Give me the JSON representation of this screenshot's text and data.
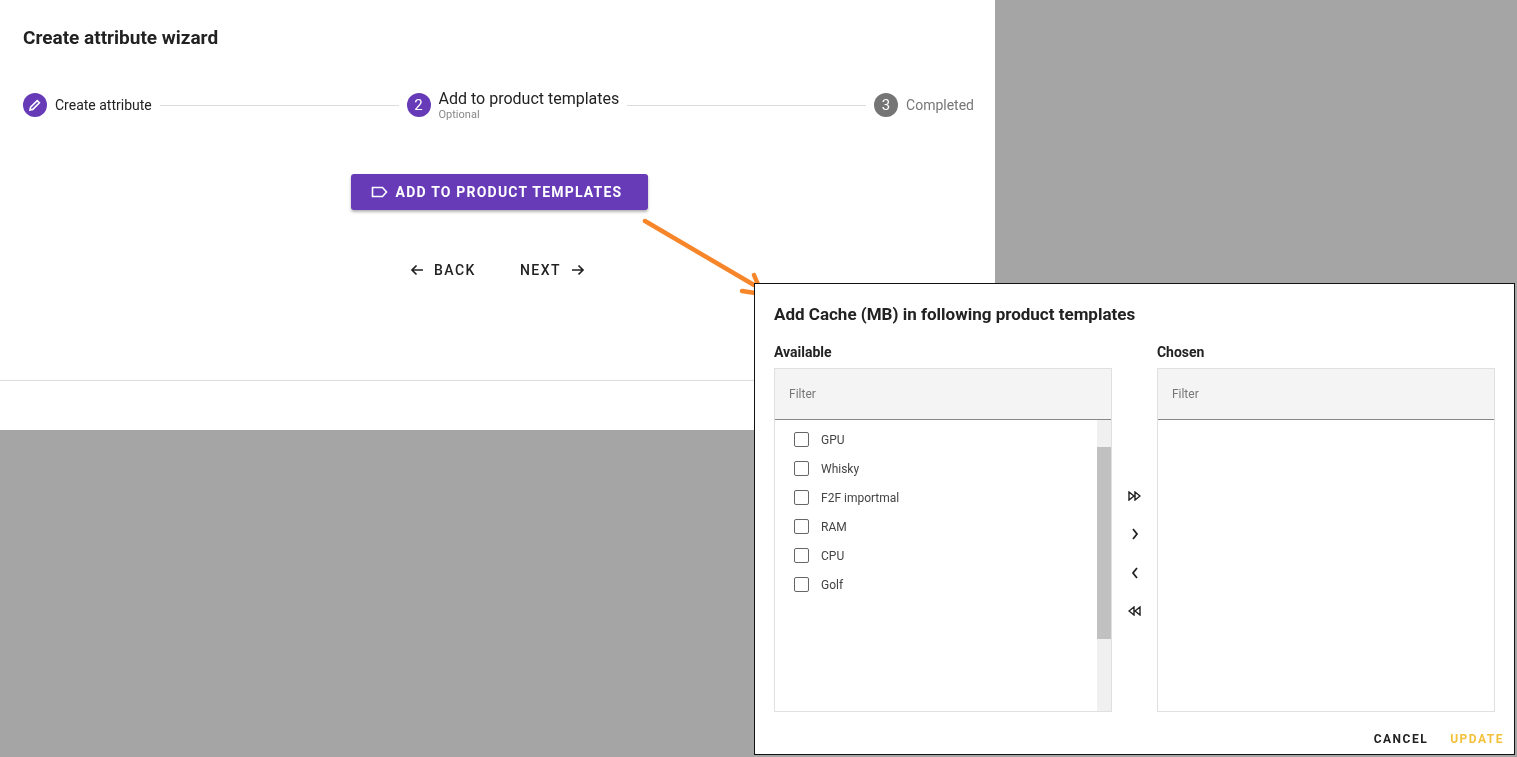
{
  "wizard": {
    "title": "Create attribute wizard",
    "steps": [
      {
        "label": "Create attribute",
        "kind": "done"
      },
      {
        "number": "2",
        "label": "Add to product templates",
        "sublabel": "Optional",
        "kind": "active"
      },
      {
        "number": "3",
        "label": "Completed",
        "kind": "pending"
      }
    ],
    "action_button": "ADD TO PRODUCT TEMPLATES",
    "back_button": "BACK",
    "next_button": "NEXT"
  },
  "dialog": {
    "title": "Add Cache (MB) in following product templates",
    "available": {
      "label": "Available",
      "filter_placeholder": "Filter",
      "items": [
        {
          "label": "GPU",
          "checked": false
        },
        {
          "label": "Whisky",
          "checked": false
        },
        {
          "label": "F2F importmal",
          "checked": false
        },
        {
          "label": "RAM",
          "checked": false
        },
        {
          "label": "CPU",
          "checked": false
        },
        {
          "label": "Golf",
          "checked": false
        }
      ]
    },
    "chosen": {
      "label": "Chosen",
      "filter_placeholder": "Filter"
    },
    "transfer_buttons": [
      {
        "kind": "all-right"
      },
      {
        "kind": "right"
      },
      {
        "kind": "left"
      },
      {
        "kind": "all-left"
      }
    ],
    "buttons": [
      {
        "label": "CANCEL",
        "kind": "plain"
      },
      {
        "label": "UPDATE",
        "kind": "primary"
      }
    ]
  }
}
